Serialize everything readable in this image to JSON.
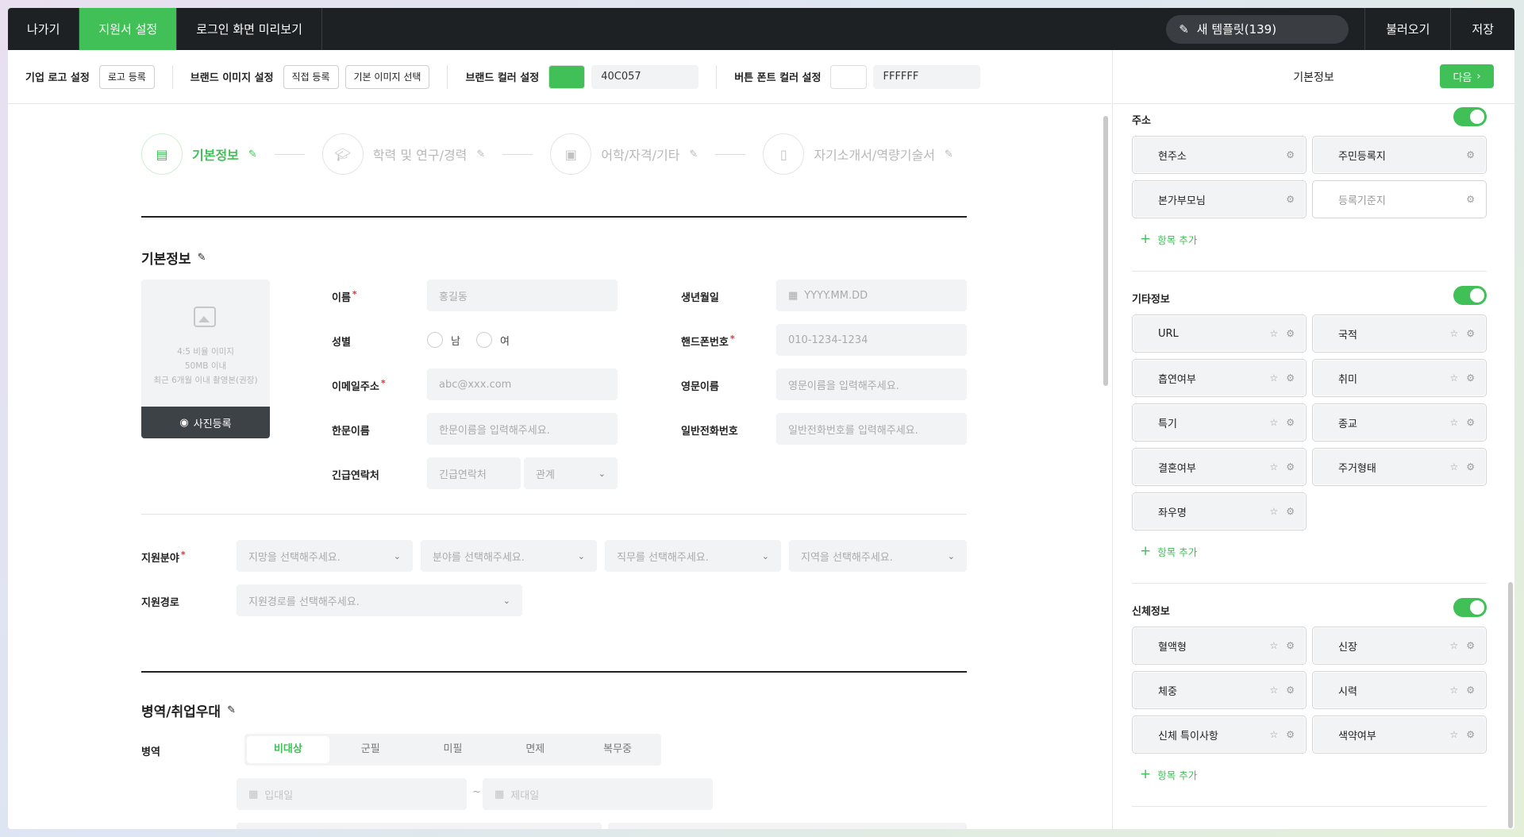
{
  "topbar": {
    "exit": "나가기",
    "settings_tab": "지원서 설정",
    "preview_tab": "로그인 화면 미리보기",
    "new_template": "새 템플릿(139)",
    "load": "불러오기",
    "save": "저장"
  },
  "toolbar": {
    "logo_label": "기업 로고 설정",
    "logo_btn": "로고 등록",
    "brand_img_label": "브랜드 이미지 설정",
    "direct_btn": "직접 등록",
    "default_img_btn": "기본 이미지 선택",
    "brand_color_label": "브랜드 컬러 설정",
    "brand_color": "#40C057",
    "brand_color_hex": "40C057",
    "font_color_label": "버튼 폰트 컬러 설정",
    "font_color": "#FFFFFF",
    "font_color_hex": "FFFFFF"
  },
  "steps": [
    {
      "label": "기본정보"
    },
    {
      "label": "학력 및 연구/경력"
    },
    {
      "label": "어학/자격/기타"
    },
    {
      "label": "자기소개서/역량기술서"
    }
  ],
  "basic": {
    "title": "기본정보",
    "photo_lines": [
      "4:5 비율 이미지",
      "50MB 이내",
      "최근 6개월 이내 촬영본(권장)"
    ],
    "photo_btn": "사진등록",
    "name_label": "이름",
    "name_ph": "홍길동",
    "birth_label": "생년월일",
    "birth_ph": "YYYY.MM.DD",
    "gender_label": "성별",
    "male": "남",
    "female": "여",
    "phone_label": "핸드폰번호",
    "phone_ph": "010-1234-1234",
    "email_label": "이메일주소",
    "email_ph": "abc@xxx.com",
    "eng_label": "영문이름",
    "eng_ph": "영문이름을 입력해주세요.",
    "hanja_label": "한문이름",
    "hanja_ph": "한문이름을 입력해주세요.",
    "tel_label": "일반전화번호",
    "tel_ph": "일반전화번호를 입력해주세요.",
    "emerg_label": "긴급연락처",
    "emerg_ph": "긴급연락처",
    "relation_ph": "관계"
  },
  "apply": {
    "field_label": "지원분야",
    "sel1": "지망을 선택해주세요.",
    "sel2": "분야를 선택해주세요.",
    "sel3": "직무를 선택해주세요.",
    "sel4": "지역을 선택해주세요.",
    "route_label": "지원경로",
    "route_ph": "지원경로를 선택해주세요."
  },
  "military": {
    "title": "병역/취업우대",
    "label": "병역",
    "options": [
      "비대상",
      "군필",
      "미필",
      "면제",
      "복무중"
    ],
    "selected": "비대상",
    "enlist_ph": "입대일",
    "discharge_ph": "제대일",
    "tilde": "~"
  },
  "panel": {
    "title": "기본정보",
    "next": "다음",
    "add_item": "항목 추가",
    "address": {
      "title": "주소",
      "items": [
        "현주소",
        "주민등록지",
        "본가부모님",
        "등록기준지"
      ]
    },
    "etc": {
      "title": "기타정보",
      "items": [
        "URL",
        "국적",
        "흡연여부",
        "취미",
        "특기",
        "종교",
        "결혼여부",
        "주거형태",
        "좌우명"
      ]
    },
    "body": {
      "title": "신체정보",
      "items": [
        "혈액형",
        "신장",
        "체중",
        "시력",
        "신체 특이사항",
        "색약여부"
      ]
    }
  }
}
